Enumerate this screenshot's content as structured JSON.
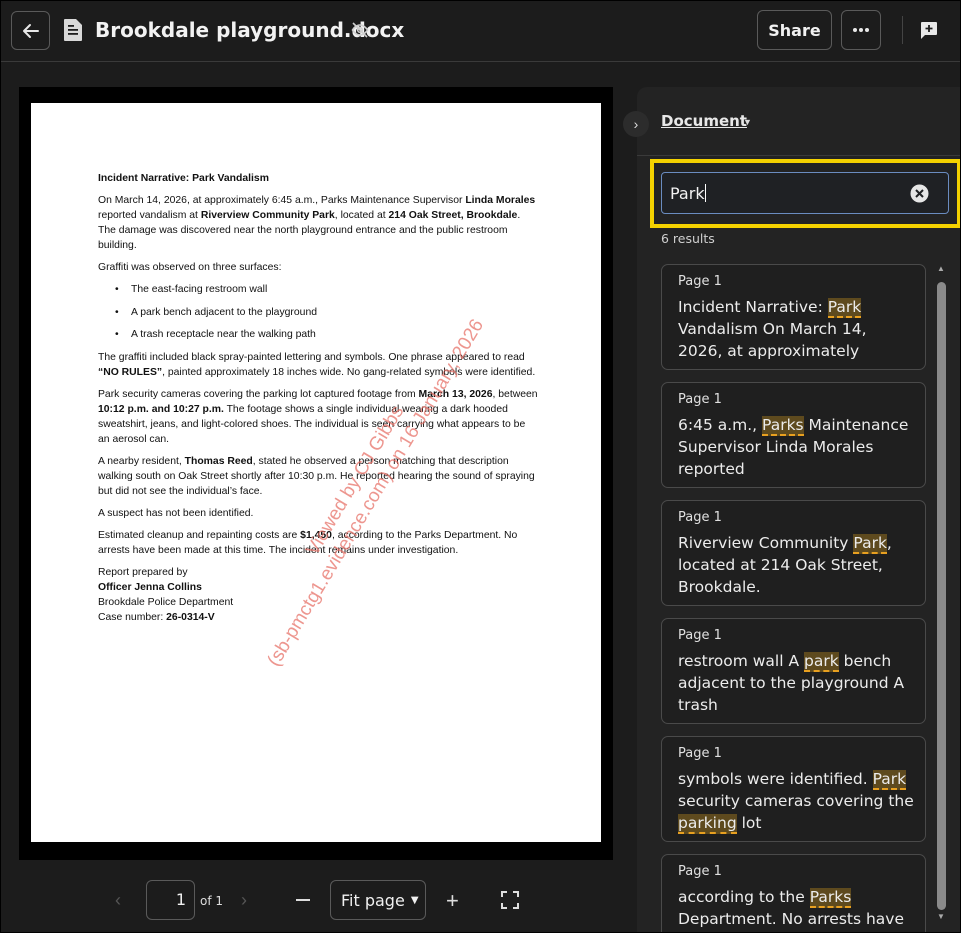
{
  "header": {
    "title": "Brookdale playground.docx",
    "share_label": "Share"
  },
  "document": {
    "heading": "Incident Narrative: Park Vandalism",
    "p1": {
      "a": "On March 14, 2026, at approximately 6:45 a.m., Parks Maintenance Supervisor ",
      "b": "Linda Morales",
      "c": " reported vandalism at ",
      "d": "Riverview Community Park",
      "e": ", located at ",
      "f": "214 Oak Street, Brookdale",
      "g": ". The damage was discovered near the north playground entrance and the public restroom building."
    },
    "p2": "Graffiti was observed on three surfaces:",
    "bullets": [
      "The east-facing restroom wall",
      "A park bench adjacent to the playground",
      "A trash receptacle near the walking path"
    ],
    "p3": {
      "a": "The graffiti included black spray-painted lettering and symbols. One phrase appeared to read ",
      "b": "“NO RULES”",
      "c": ", painted approximately 18 inches wide. No gang-related symbols were identified."
    },
    "p4": {
      "a": "Park security cameras covering the parking lot captured footage from ",
      "b": "March 13, 2026",
      "c": ", between ",
      "d": "10:12 p.m. and 10:27 p.m.",
      "e": " The footage shows a single individual wearing a dark hooded sweatshirt, jeans, and light-colored shoes. The individual is seen carrying what appears to be an aerosol can."
    },
    "p5": {
      "a": "A nearby resident, ",
      "b": "Thomas Reed",
      "c": ", stated he observed a person matching that description walking south on Oak Street shortly after 10:30 p.m. He reported hearing the sound of spraying but did not see the individual’s face."
    },
    "p6": "A suspect has not been identified.",
    "p7": {
      "a": "Estimated cleanup and repainting costs are ",
      "b": "$1,450",
      "c": ", according to the Parks Department. No arrests have been made at this time. The incident remains under investigation."
    },
    "sig": {
      "line1": "Report prepared by",
      "officer": "Officer Jenna Collins",
      "dept": "Brookdale Police Department",
      "case_label": "Case number: ",
      "case_number": "26-0314-V"
    },
    "watermark_line1": "Viewed by CJ Gibbs",
    "watermark_line2": "(sb-pmctg1.evidence.com) on 16 January, 2026"
  },
  "viewer_toolbar": {
    "page_value": "1",
    "page_of": "of 1",
    "zoom_label": "Fit page"
  },
  "panel": {
    "title": "Document",
    "search_value": "Park",
    "results_count": "6 results",
    "results": [
      {
        "page": "Page 1",
        "before": "Incident Narrative: ",
        "match": "Park",
        "after": " Vandalism On March 14, 2026, at approximately"
      },
      {
        "page": "Page 1",
        "before": "6:45 a.m., ",
        "match": "Parks",
        "after": " Maintenance Supervisor Linda Morales reported"
      },
      {
        "page": "Page 1",
        "before": "Riverview Community ",
        "match": "Park",
        "after": ", located at 214 Oak Street, Brookdale."
      },
      {
        "page": "Page 1",
        "before": "restroom wall A ",
        "match": "park",
        "after": " bench adjacent to the playground A trash"
      },
      {
        "page": "Page 1",
        "before": "symbols were identified. ",
        "match": "Park",
        "mid": " security cameras covering the ",
        "match2": "parking",
        "after": " lot"
      },
      {
        "page": "Page 1",
        "before": "according to the ",
        "match": "Parks",
        "after": " Department. No arrests have"
      }
    ]
  }
}
